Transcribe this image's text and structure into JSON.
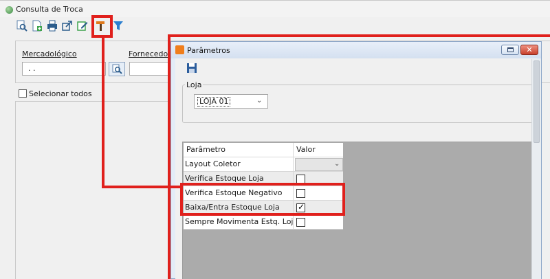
{
  "main": {
    "title": "Consulta de Troca",
    "toolbar": {
      "icons": [
        "search-document-icon",
        "new-document-icon",
        "print-icon",
        "export-icon",
        "edit-icon",
        "tools-hammer-icon",
        "filter-funnel-icon"
      ]
    },
    "filters": {
      "mercadologico_label": "Mercadológico",
      "mercadologico_value": ". .",
      "fornecedor_label": "Fornecedor"
    },
    "selecionar_todos": "Selecionar todos"
  },
  "dialog": {
    "title": "Parâmetros",
    "close_label": "✕",
    "loja": {
      "legend": "Loja",
      "selected": "LOJA 01"
    },
    "grid": {
      "headers": [
        "Parâmetro",
        "Valor"
      ],
      "rows": [
        {
          "param": "Layout Coletor",
          "type": "dropdown",
          "value": ""
        },
        {
          "param": "Verifica Estoque Loja",
          "type": "checkbox",
          "checked": false
        },
        {
          "param": "Verifica Estoque Negativo",
          "type": "checkbox",
          "checked": false
        },
        {
          "param": "Baixa/Entra Estoque Loja",
          "type": "checkbox",
          "checked": true
        },
        {
          "param": "Sempre Movimenta Estq. Loja",
          "type": "checkbox",
          "checked": false
        }
      ]
    }
  },
  "colors": {
    "highlight": "#e0201c",
    "dialog_border": "#8aa5c8",
    "close_button": "#c8402c"
  }
}
